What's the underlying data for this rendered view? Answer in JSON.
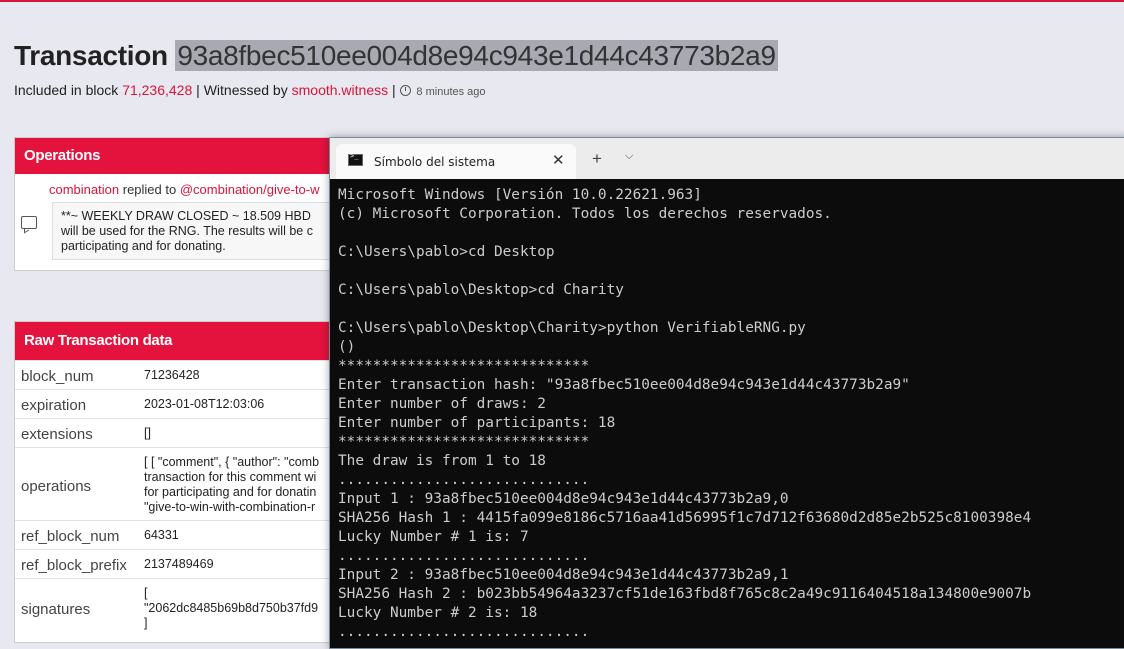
{
  "transaction": {
    "title_prefix": "Transaction",
    "hash": "93a8fbec510ee004d8e94c943e1d44c43773b2a9",
    "included_text": "Included in block",
    "block_number": "71,236,428",
    "separator": "|",
    "witnessed_text": "Witnessed by",
    "witness": "smooth.witness",
    "time_ago": "8 minutes ago"
  },
  "operations": {
    "header": "Operations",
    "author": "combination",
    "action": "replied to",
    "target": "@combination/give-to-w",
    "body_lines": [
      "**~ WEEKLY DRAW CLOSED ~ 18.509 HBD",
      "will be used for the RNG. The results will be c",
      "participating and for donating."
    ]
  },
  "raw": {
    "header": "Raw Transaction data",
    "rows": [
      {
        "key": "block_num",
        "value": "71236428"
      },
      {
        "key": "expiration",
        "value": "2023-01-08T12:03:06"
      },
      {
        "key": "extensions",
        "value": "[]"
      },
      {
        "key": "operations",
        "value": "[ [ \"comment\", { \"author\": \"comb\ntransaction for this comment wi\nfor participating and for donatin\n\"give-to-win-with-combination-r"
      },
      {
        "key": "ref_block_num",
        "value": "64331"
      },
      {
        "key": "ref_block_prefix",
        "value": "2137489469"
      },
      {
        "key": "signatures",
        "value": "[\n\"2062dc8485b69b8d750b37fd9\n]"
      }
    ]
  },
  "terminal": {
    "tab_title": "Símbolo del sistema",
    "close_glyph": "✕",
    "new_tab_glyph": "+",
    "dropdown_glyph": "⌵",
    "lines": [
      "Microsoft Windows [Versión 10.0.22621.963]",
      "(c) Microsoft Corporation. Todos los derechos reservados.",
      "",
      "C:\\Users\\pablo>cd Desktop",
      "",
      "C:\\Users\\pablo\\Desktop>cd Charity",
      "",
      "C:\\Users\\pablo\\Desktop\\Charity>python VerifiableRNG.py",
      "()",
      "*****************************",
      "Enter transaction hash: \"93a8fbec510ee004d8e94c943e1d44c43773b2a9\"",
      "Enter number of draws: 2",
      "Enter number of participants: 18",
      "*****************************",
      "The draw is from 1 to 18",
      ".............................",
      "Input 1 : 93a8fbec510ee004d8e94c943e1d44c43773b2a9,0",
      "SHA256 Hash 1 : 4415fa099e8186c5716aa41d56995f1c7d712f63680d2d85e2b525c8100398e4",
      "Lucky Number # 1 is: 7",
      ".............................",
      "Input 2 : 93a8fbec510ee004d8e94c943e1d44c43773b2a9,1",
      "SHA256 Hash 2 : b023bb54964a3237cf51de163fbd8f765c8c2a49c9116404518a134800e9007b",
      "Lucky Number # 2 is: 18",
      "............................."
    ]
  }
}
